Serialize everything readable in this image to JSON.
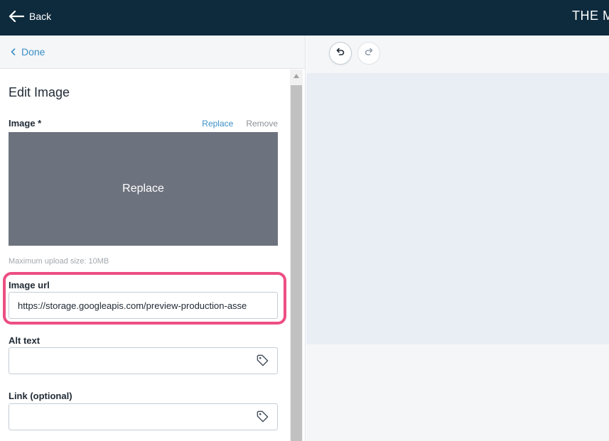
{
  "topbar": {
    "back_label": "Back",
    "app_title": "THE M"
  },
  "panel": {
    "done_label": "Done",
    "title": "Edit Image",
    "image_label": "Image *",
    "replace_action": "Replace",
    "remove_action": "Remove",
    "image_overlay_label": "Replace",
    "upload_hint": "Maximum upload size: 10MB",
    "image_url_label": "Image url",
    "image_url_value": "https://storage.googleapis.com/preview-production-asse",
    "alt_text_label": "Alt text",
    "alt_text_value": "",
    "link_label": "Link (optional)",
    "link_value": ""
  },
  "icons": {
    "back": "arrow-left-icon",
    "done": "chevron-left-icon",
    "tag": "tag-icon",
    "undo": "undo-icon",
    "redo": "redo-icon",
    "scroll_up": "triangle-up-icon"
  },
  "colors": {
    "topbar_bg": "#0e2b3d",
    "link_blue": "#3d8fc7",
    "highlight_pink": "#ec4f83",
    "image_placeholder": "#6d737e",
    "preview_bg": "#e9eef5"
  }
}
